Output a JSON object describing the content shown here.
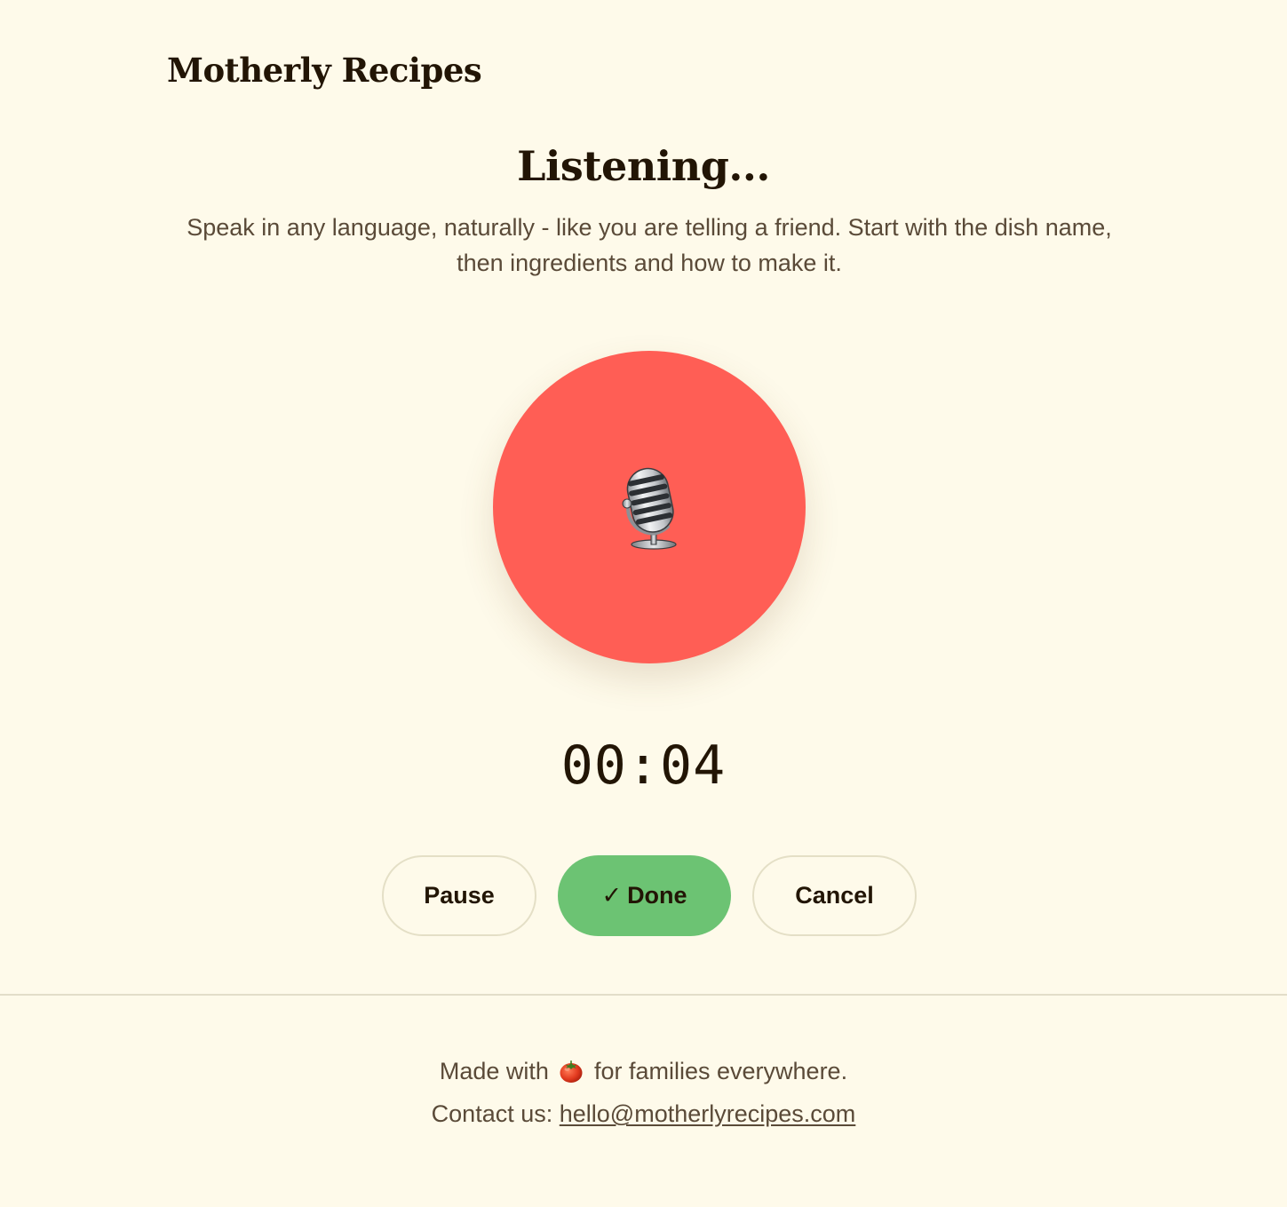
{
  "header": {
    "brand": "Motherly Recipes"
  },
  "main": {
    "title": "Listening...",
    "subtitle": "Speak in any language, naturally - like you are telling a friend. Start with the dish name, then ingredients and how to make it.",
    "record_button_icon": "microphone-icon",
    "record_color": "#ff5e55",
    "timer": "00:04"
  },
  "controls": {
    "pause_label": "Pause",
    "done_check": "✓",
    "done_label": "Done",
    "cancel_label": "Cancel",
    "done_color": "#6cc373"
  },
  "footer": {
    "made_prefix": "Made with",
    "made_icon": "tomato-icon",
    "made_suffix": "for families everywhere.",
    "contact_label": "Contact us:",
    "contact_email": "hello@motherlyrecipes.com"
  },
  "colors": {
    "background": "#fefaea",
    "text_dark": "#221505",
    "text_muted": "#5a4a38",
    "divider": "#e2ddc9"
  }
}
